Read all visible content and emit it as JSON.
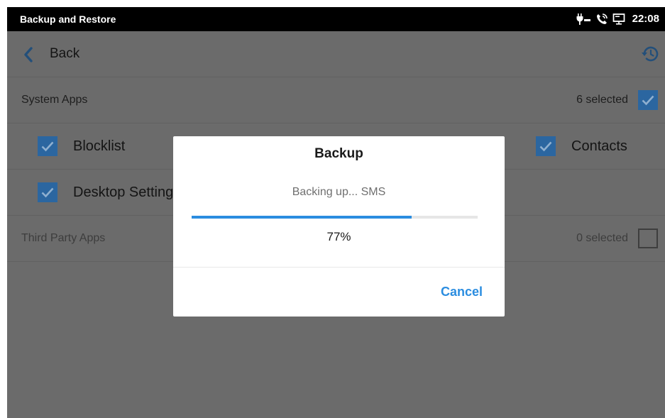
{
  "statusbar": {
    "title": "Backup and Restore",
    "time": "22:08",
    "icons": [
      "poe-power-icon",
      "phone-call-icon",
      "monitor-icon"
    ]
  },
  "nav": {
    "back_label": "Back",
    "back_icon": "chevron-left-icon",
    "history_icon": "history-icon"
  },
  "system_apps": {
    "label": "System Apps",
    "count": "6 selected",
    "checked": true,
    "items": [
      {
        "label": "Blocklist",
        "checked": true
      },
      {
        "label": "Contacts",
        "checked": true
      },
      {
        "label": "Desktop Settings",
        "checked": true
      }
    ]
  },
  "third_party_apps": {
    "label": "Third Party Apps",
    "count": "0 selected",
    "checked": false
  },
  "dialog": {
    "title": "Backup",
    "message": "Backing up... SMS",
    "progress": 77,
    "progress_text": "77%",
    "cancel_label": "Cancel"
  },
  "colors": {
    "accent": "#2b8de0",
    "checkbox": "#2b66a0",
    "overlay": "#6b6b6b"
  }
}
